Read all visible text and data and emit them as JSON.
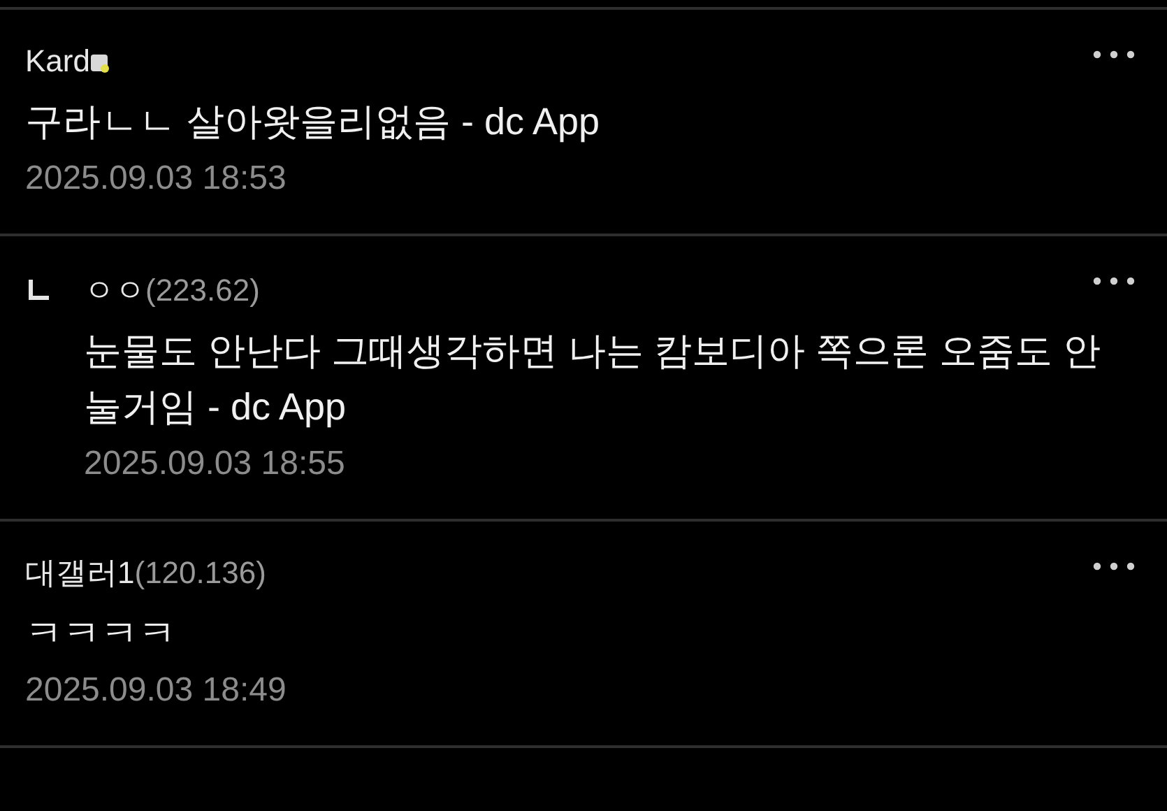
{
  "comments": [
    {
      "kind": "comment",
      "author": "Kard",
      "fixed_nick_badge": true,
      "text": "구라ㄴㄴ 살아왓을리없음 - dc App",
      "time": "2025.09.03 18:53"
    },
    {
      "kind": "reply",
      "author": "ㅇㅇ",
      "ip": "(223.62)",
      "fixed_nick_badge": false,
      "text": "눈물도 안난다 그때생각하면 나는 캄보디아 쪽으론 오줌도 안 눌거임 - dc App",
      "time": "2025.09.03 18:55"
    },
    {
      "kind": "comment",
      "author": "대갤러1",
      "ip": "(120.136)",
      "fixed_nick_badge": false,
      "text": "ㅋㅋㅋㅋ",
      "time": "2025.09.03 18:49"
    }
  ]
}
